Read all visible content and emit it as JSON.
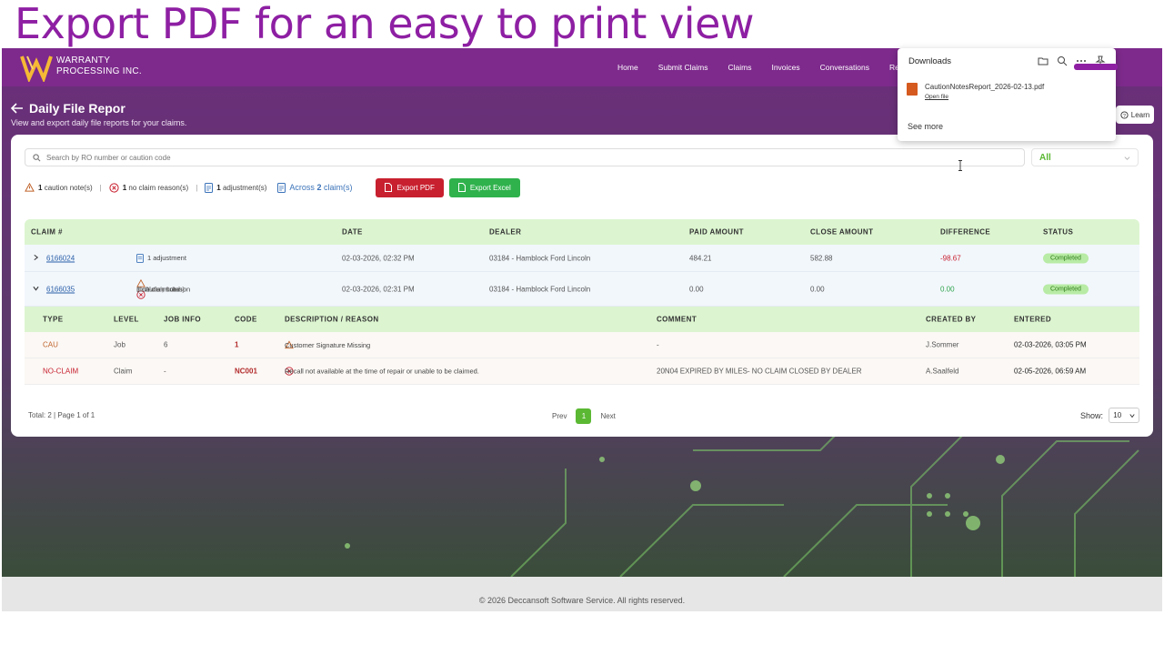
{
  "caption": "Export PDF for an easy to print view",
  "brand": {
    "line1": "WARRANTY",
    "line2": "PROCESSING INC."
  },
  "nav": [
    "Home",
    "Submit Claims",
    "Claims",
    "Invoices",
    "Conversations",
    "Rep"
  ],
  "page": {
    "title": "Daily File Repor",
    "subtitle": "View and export daily file reports for your claims.",
    "learn": "Learn"
  },
  "search": {
    "placeholder": "Search by RO number or caution code",
    "filter": "All"
  },
  "summary": {
    "caution_count": "1",
    "caution_text": "caution note(s)",
    "noclaim_count": "1",
    "noclaim_text": "no claim reason(s)",
    "adjust_count": "1",
    "adjust_text": "adjustment(s)",
    "across_pre": "Across",
    "across_count": "2",
    "across_post": "claim(s)",
    "sep": "|",
    "export_pdf": "Export PDF",
    "export_excel": "Export Excel"
  },
  "columns": [
    "CLAIM #",
    "DATE",
    "DEALER",
    "PAID AMOUNT",
    "CLOSE AMOUNT",
    "DIFFERENCE",
    "STATUS"
  ],
  "rows": [
    {
      "claim": "6166024",
      "note1": "1 adjustment",
      "date": "02-03-2026, 02:32 PM",
      "dealer": "03184 - Hamblock Ford Lincoln",
      "paid": "484.21",
      "close": "582.88",
      "diff": "-98.67",
      "status": "Completed"
    },
    {
      "claim": "6166035",
      "note1": "1 caution note",
      "note1_muted": "(0 Claim, 1 Job)",
      "note2": "1 no claim reason",
      "note2_muted": "(1 Claim, 0 Job)",
      "date": "02-03-2026, 02:31 PM",
      "dealer": "03184 - Hamblock Ford Lincoln",
      "paid": "0.00",
      "close": "0.00",
      "diff": "0.00",
      "status": "Completed"
    }
  ],
  "sub_columns": [
    "TYPE",
    "LEVEL",
    "JOB INFO",
    "CODE",
    "DESCRIPTION / REASON",
    "COMMENT",
    "CREATED BY",
    "ENTERED"
  ],
  "sub_rows": [
    {
      "type": "CAU",
      "level": "Job",
      "job": "6",
      "code": "1",
      "desc": "Customer Signature Missing",
      "comment": "-",
      "by": "J.Sommer",
      "entered": "02-03-2026, 03:05 PM"
    },
    {
      "type": "NO-CLAIM",
      "level": "Claim",
      "job": "-",
      "code": "NC001",
      "desc": "Recall not available at the time of repair or unable to be claimed.",
      "comment": "20N04 EXPIRED BY MILES- NO CLAIM CLOSED BY DEALER",
      "by": "A.Saalfeld",
      "entered": "02-05-2026, 06:59 AM"
    }
  ],
  "pagination": {
    "total": "Total: 2 | Page 1 of 1",
    "prev": "Prev",
    "page": "1",
    "next": "Next",
    "show_label": "Show:",
    "show_value": "10"
  },
  "footer": "© 2026 Deccansoft Software Service. All rights reserved.",
  "downloads": {
    "title": "Downloads",
    "file": "CautionNotesReport_2026-02-13.pdf",
    "open": "Open file",
    "more": "See more"
  },
  "colors": {
    "brand_purple": "#7d2a8c",
    "accent_green": "#5bb833",
    "export_red": "#c8202f",
    "excel_green": "#2fb24c",
    "header_green": "#dcf5d0"
  }
}
